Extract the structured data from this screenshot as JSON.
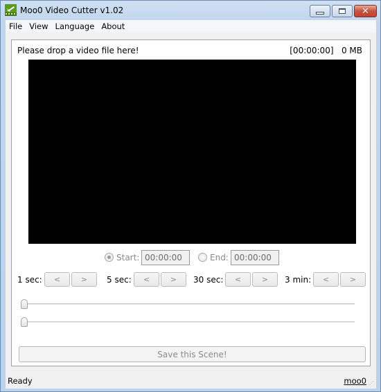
{
  "window": {
    "title": "Moo0 Video Cutter v1.02",
    "icon": "film-cut-icon",
    "controls": {
      "minimize": "minimize-icon",
      "maximize": "maximize-icon",
      "close": "close-icon",
      "close_glyph": "✕"
    }
  },
  "menubar": {
    "items": [
      {
        "label": "File"
      },
      {
        "label": "View"
      },
      {
        "label": "Language"
      },
      {
        "label": "About"
      }
    ]
  },
  "main": {
    "drop_prompt": "Please drop a video file here!",
    "duration_info": "[00:00:00]   0 MB",
    "start": {
      "label": "Start:",
      "value": "00:00:00",
      "selected": true
    },
    "end": {
      "label": "End:",
      "value": "00:00:00",
      "selected": false
    },
    "steps": [
      {
        "label": "1 sec:",
        "back": "<",
        "forward": ">"
      },
      {
        "label": "5 sec:",
        "back": "<",
        "forward": ">"
      },
      {
        "label": "30 sec:",
        "back": "<",
        "forward": ">"
      },
      {
        "label": "3 min:",
        "back": "<",
        "forward": ">"
      }
    ],
    "sliders": {
      "start_position": 0,
      "end_position": 0
    },
    "save_label": "Save this Scene!"
  },
  "statusbar": {
    "status": "Ready",
    "link": "moo0"
  }
}
